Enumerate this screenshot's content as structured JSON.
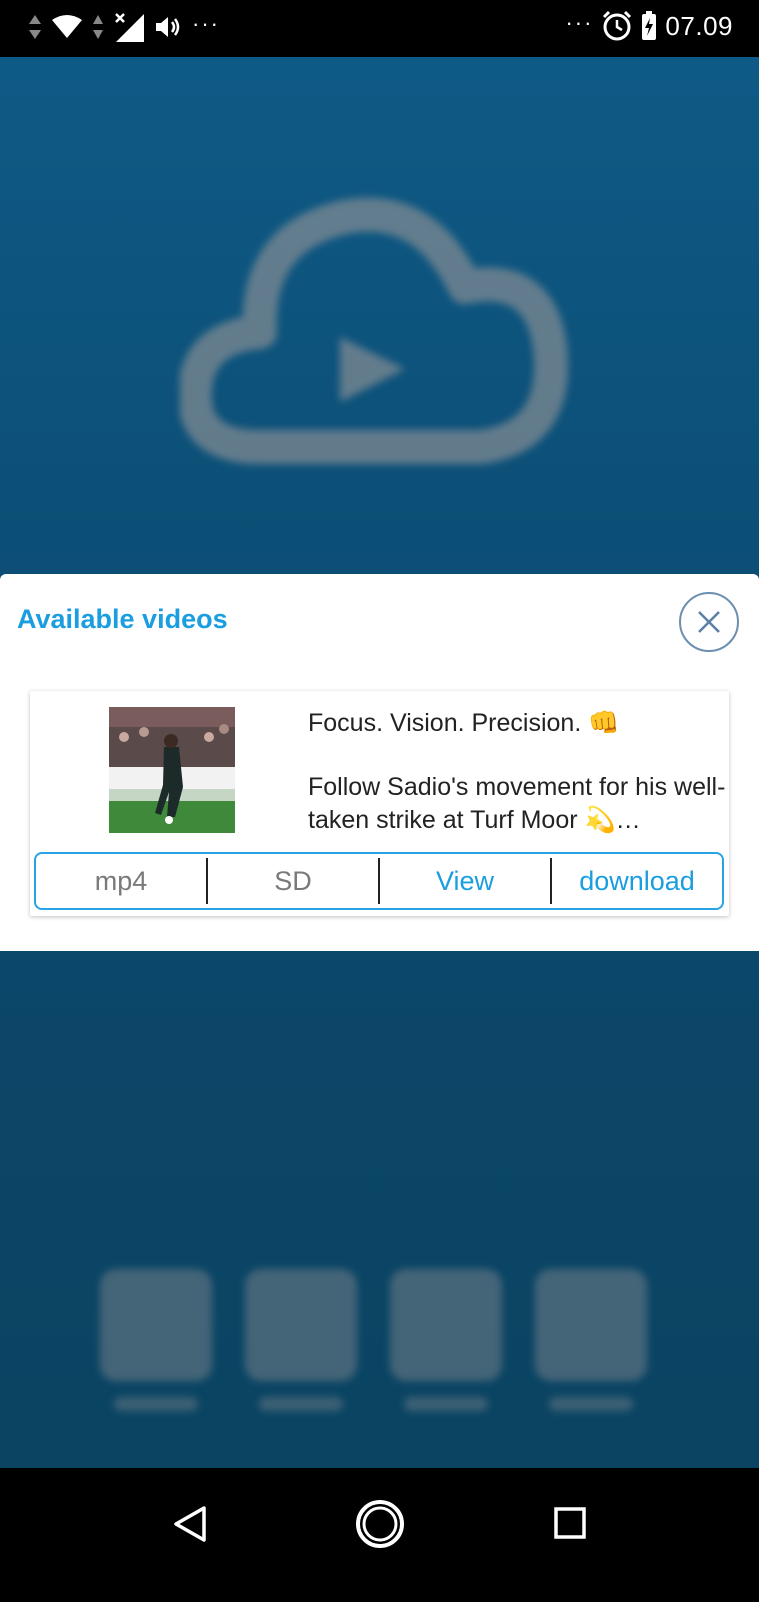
{
  "status_bar": {
    "time": "07.09",
    "left_icons": [
      "data-arrows-icon",
      "wifi-icon",
      "signal-off-icon",
      "volume-icon",
      "more-dots-icon"
    ],
    "right_icons": [
      "more-dots-icon",
      "alarm-icon",
      "battery-charging-icon"
    ],
    "left_dots": "···",
    "right_dots": "···"
  },
  "modal": {
    "title": "Available videos",
    "close_icon": "close-icon"
  },
  "video": {
    "caption_line1": "Focus. Vision. Precision. 👊",
    "caption_line2": "Follow Sadio's movement for his well-taken strike at Turf Moor 💫…",
    "format": "mp4",
    "quality": "SD",
    "view_label": "View",
    "download_label": "download"
  },
  "colors": {
    "accent": "#1a9ee0",
    "app_background": "#0c4d73",
    "button_border": "#2aa3e6"
  },
  "nav_bar": {
    "back_icon": "back-triangle-icon",
    "home_icon": "home-circle-icon",
    "recents_icon": "recents-square-icon"
  }
}
